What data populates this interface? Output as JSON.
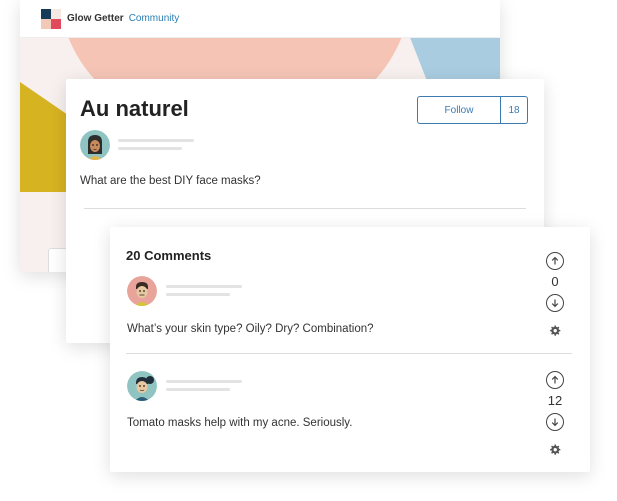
{
  "header": {
    "brand": "Glow Getter",
    "section": "Community"
  },
  "colors": {
    "accent": "#3b7bb0",
    "brand_navy": "#163a57",
    "brand_red": "#e04a5c",
    "banner_salmon": "#f5c4b5",
    "banner_blue": "#a9cce0",
    "banner_gold": "#d6b321"
  },
  "post": {
    "title": "Au naturel",
    "follow_label": "Follow",
    "follow_count": "18",
    "question": "What are the best DIY face masks?"
  },
  "comments": {
    "title": "20 Comments",
    "items": [
      {
        "text": "What’s your skin type? Oily? Dry? Combination?",
        "votes": "0"
      },
      {
        "text": "Tomato masks help with my acne. Seriously.",
        "votes": "12"
      }
    ]
  },
  "icons": {
    "upvote": "arrow-up-circle-icon",
    "downvote": "arrow-down-circle-icon",
    "settings": "gear-icon"
  }
}
